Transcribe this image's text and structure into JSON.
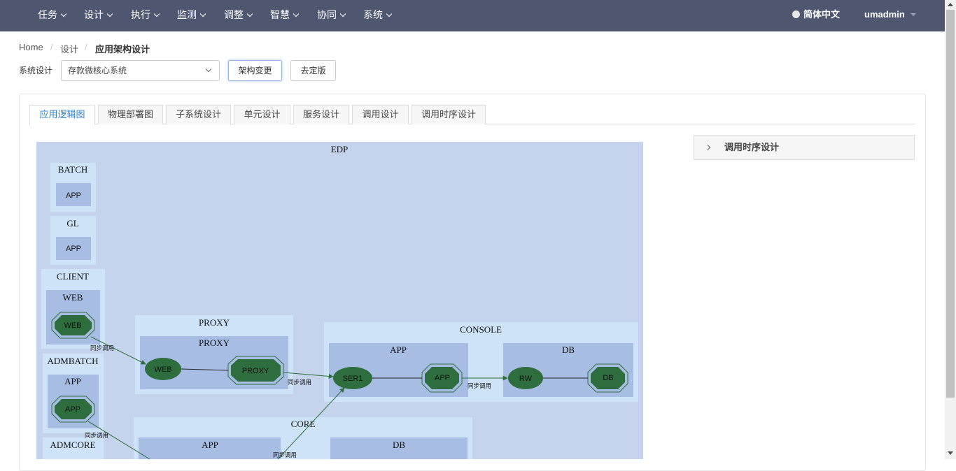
{
  "nav": {
    "items": [
      "任务",
      "设计",
      "执行",
      "监测",
      "调整",
      "智慧",
      "协同",
      "系统"
    ],
    "language": "简体中文",
    "user": "umadmin"
  },
  "breadcrumb": [
    "Home",
    "设计",
    "应用架构设计"
  ],
  "system_select": {
    "label": "系统设计",
    "value": "存款微核心系统"
  },
  "buttons": {
    "change": "架构变更",
    "unfinalize": "去定版"
  },
  "tabs": [
    "应用逻辑图",
    "物理部署图",
    "子系统设计",
    "单元设计",
    "服务设计",
    "调用设计",
    "调用时序设计"
  ],
  "active_tab": 0,
  "side_panel": {
    "title": "调用时序设计"
  },
  "diagram": {
    "root": "EDP",
    "clusters": {
      "batch": "BATCH",
      "gl": "GL",
      "client": "CLIENT",
      "client_web": "WEB",
      "admbatch": "ADMBATCH",
      "admbatch_app": "APP",
      "admcore": "ADMCORE",
      "proxy": "PROXY",
      "proxy_inner": "PROXY",
      "console": "CONSOLE",
      "console_app": "APP",
      "console_db": "DB",
      "core": "CORE",
      "core_app": "APP",
      "core_db": "DB"
    },
    "nodes": {
      "batch_app": "APP",
      "gl_app": "APP",
      "client_web": "WEB",
      "admbatch_app": "APP",
      "proxy_web": "WEB",
      "proxy_proxy": "PROXY",
      "console_ser1": "SER1",
      "console_app": "APP",
      "console_rw": "RW",
      "console_db": "DB"
    },
    "edge_label": "同步调用",
    "colors": {
      "outer": "#c5d3ec",
      "inner": "#cfe3f8",
      "innermost": "#a8bde4",
      "node": "#2e6e3e",
      "edge": "#2e6e3e"
    }
  }
}
